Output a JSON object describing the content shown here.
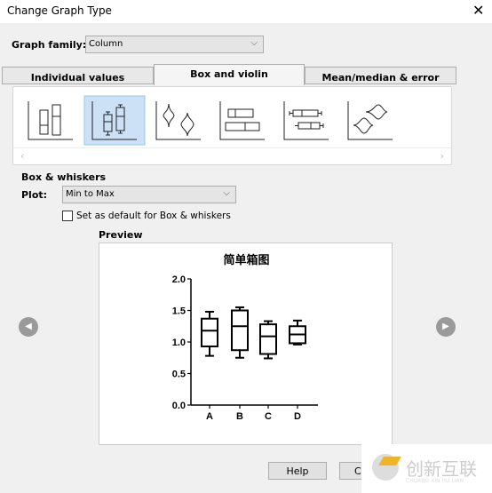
{
  "window": {
    "title": "Change Graph Type",
    "close_icon": "close-icon"
  },
  "graph_family": {
    "label": "Graph family:",
    "value": "Column"
  },
  "tabs": [
    {
      "label": "Individual values",
      "active": false
    },
    {
      "label": "Box and violin",
      "active": true
    },
    {
      "label": "Mean/median & error",
      "active": false
    }
  ],
  "gallery": {
    "items": [
      "floating-bars",
      "box-whiskers-vertical",
      "violin-vertical",
      "floating-bars-horizontal",
      "box-whiskers-horizontal",
      "violin-horizontal"
    ],
    "selected": 1
  },
  "section": {
    "title": "Box & whiskers",
    "plot_label": "Plot:",
    "plot_value": "Min to Max",
    "default_checkbox": "Set as default for Box & whiskers",
    "default_checked": false
  },
  "preview": {
    "label": "Preview"
  },
  "buttons": {
    "help": "Help",
    "cancel": "C"
  },
  "watermark": {
    "text": "创新互联",
    "sub": "CHUANG XIN HU LIAN"
  },
  "chart_data": {
    "type": "box",
    "title": "简单箱图",
    "categories": [
      "A",
      "B",
      "C",
      "D"
    ],
    "ylim": [
      0,
      2.0
    ],
    "yticks": [
      "0.0",
      "0.5",
      "1.0",
      "1.5",
      "2.0"
    ],
    "boxes": [
      {
        "min": 0.78,
        "q1": 0.93,
        "median": 1.18,
        "q3": 1.37,
        "max": 1.48
      },
      {
        "min": 0.75,
        "q1": 0.87,
        "median": 1.25,
        "q3": 1.5,
        "max": 1.55
      },
      {
        "min": 0.74,
        "q1": 0.81,
        "median": 1.09,
        "q3": 1.28,
        "max": 1.33
      },
      {
        "min": 0.96,
        "q1": 0.98,
        "median": 1.12,
        "q3": 1.25,
        "max": 1.34
      }
    ]
  }
}
